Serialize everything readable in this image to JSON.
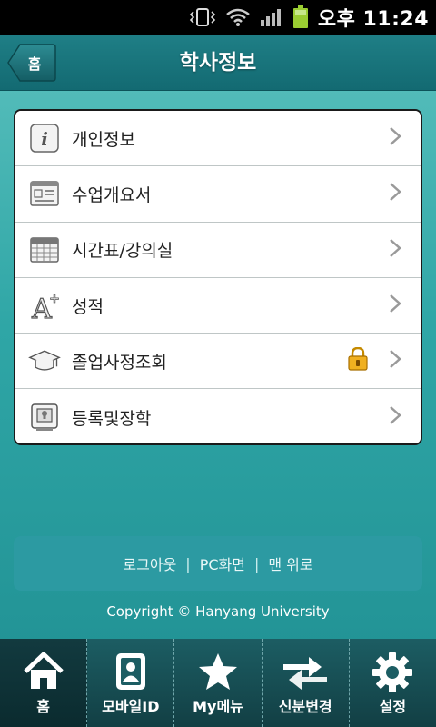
{
  "status_bar": {
    "time": "오후 11:24"
  },
  "header": {
    "home_label": "홈",
    "title": "학사정보"
  },
  "menu": {
    "items": [
      {
        "label": "개인정보",
        "icon": "info-icon",
        "locked": false
      },
      {
        "label": "수업개요서",
        "icon": "syllabus-icon",
        "locked": false
      },
      {
        "label": "시간표/강의실",
        "icon": "timetable-icon",
        "locked": false
      },
      {
        "label": "성적",
        "icon": "grade-a-plus-icon",
        "locked": false
      },
      {
        "label": "졸업사정조회",
        "icon": "graduation-cap-icon",
        "locked": true
      },
      {
        "label": "등록및장학",
        "icon": "registration-icon",
        "locked": false
      }
    ]
  },
  "footer": {
    "logout": "로그아웃",
    "pc_view": "PC화면",
    "to_top": "맨 위로",
    "separator": "|",
    "copyright": "Copyright © Hanyang University"
  },
  "tabbar": {
    "tabs": [
      {
        "label": "홈",
        "icon": "home-icon",
        "active": true
      },
      {
        "label": "모바일ID",
        "icon": "mobile-id-icon",
        "active": false
      },
      {
        "label": "My메뉴",
        "icon": "star-icon",
        "active": false
      },
      {
        "label": "신분변경",
        "icon": "swap-arrows-icon",
        "active": false
      },
      {
        "label": "설정",
        "icon": "gear-icon",
        "active": false
      }
    ]
  }
}
